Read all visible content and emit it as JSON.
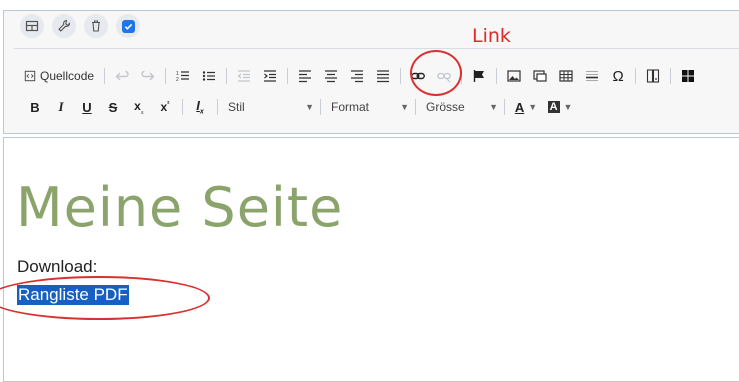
{
  "annotation": {
    "link_label": "Link"
  },
  "header_icons": [
    {
      "name": "layout-icon"
    },
    {
      "name": "wrench-icon"
    },
    {
      "name": "trash-icon"
    },
    {
      "name": "checkbox-icon",
      "checked": true
    }
  ],
  "toolbar": {
    "source_label": "Quellcode",
    "style_label": "Stil",
    "format_label": "Format",
    "size_label": "Grösse"
  },
  "content": {
    "title": "Meine Seite",
    "download_label": "Download:",
    "link_text": "Rangliste PDF"
  },
  "colors": {
    "title_green": "#8ba46b",
    "selection_blue": "#1560c2",
    "annotation_red": "#e02828",
    "checkbox_blue": "#1e74e8"
  }
}
